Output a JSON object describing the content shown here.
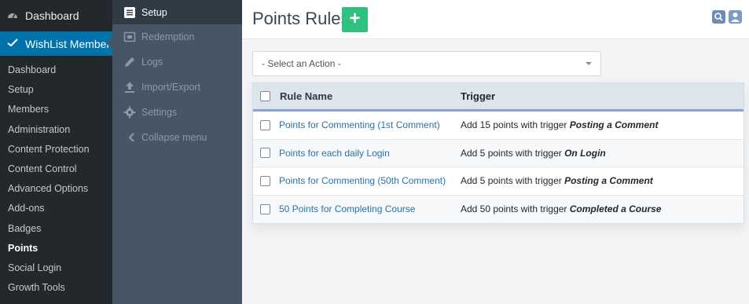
{
  "wp_menu": {
    "dashboard_label": "Dashboard",
    "current_label": "WishList Member",
    "submenu": [
      "Dashboard",
      "Setup",
      "Members",
      "Administration",
      "Content Protection",
      "Content Control",
      "Advanced Options",
      "Add-ons",
      "Badges",
      "Points",
      "Social Login",
      "Growth Tools"
    ],
    "active_item": "Points"
  },
  "plugin_nav": {
    "items": [
      {
        "label": "Setup",
        "icon": "list-icon",
        "active": true
      },
      {
        "label": "Redemption",
        "icon": "ticket-icon",
        "active": false
      },
      {
        "label": "Logs",
        "icon": "pencil-icon",
        "active": false
      },
      {
        "label": "Import/Export",
        "icon": "upload-icon",
        "active": false
      },
      {
        "label": "Settings",
        "icon": "gear-icon",
        "active": false
      }
    ],
    "collapse_label": "Collapse menu"
  },
  "header": {
    "title": "Points Rules",
    "add_label": "+"
  },
  "action_select": {
    "value": "- Select an Action -"
  },
  "table": {
    "headers": {
      "name": "Rule Name",
      "trigger": "Trigger"
    },
    "rows": [
      {
        "name": "Points for Commenting (1st Comment)",
        "trigger_prefix": "Add 15 points with trigger",
        "trigger": "Posting a Comment"
      },
      {
        "name": "Points for each daily Login",
        "trigger_prefix": "Add 5 points with trigger",
        "trigger": "On Login"
      },
      {
        "name": "Points for Commenting (50th Comment)",
        "trigger_prefix": "Add 5 points with trigger",
        "trigger": "Posting a Comment"
      },
      {
        "name": "50 Points for Completing Course",
        "trigger_prefix": "Add 50 points with trigger",
        "trigger": "Completed a Course"
      }
    ]
  },
  "colors": {
    "wp_sidebar": "#23282d",
    "wp_current": "#0073aa",
    "plugin_nav": "#475566",
    "add_button": "#2ec27e",
    "link": "#2a72a8"
  }
}
